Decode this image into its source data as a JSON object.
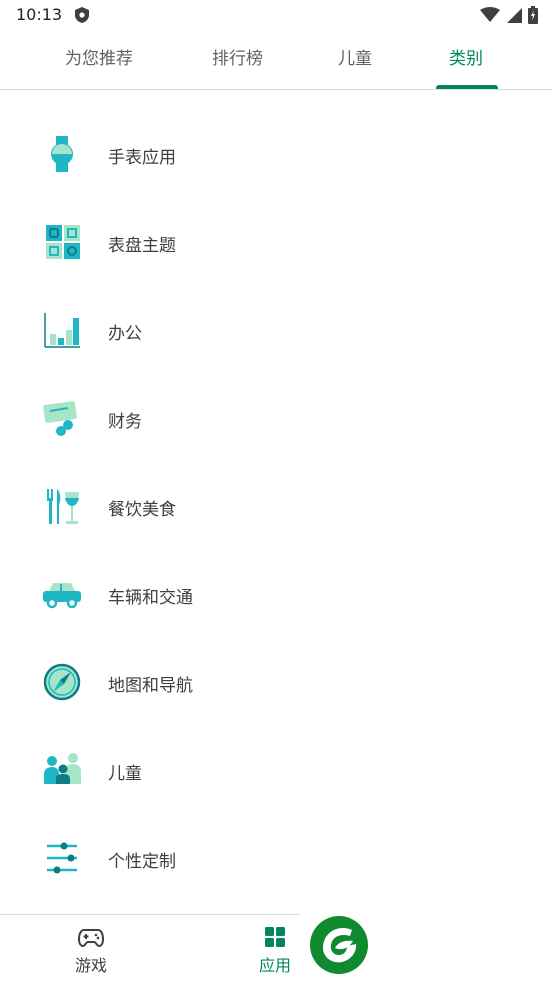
{
  "status": {
    "time": "10:13"
  },
  "tabs": [
    {
      "label": "为您推荐"
    },
    {
      "label": "排行榜"
    },
    {
      "label": "儿童"
    },
    {
      "label": "类别"
    }
  ],
  "categories": [
    {
      "label": "手表应用",
      "icon": "watch-icon"
    },
    {
      "label": "表盘主题",
      "icon": "watch-faces-icon"
    },
    {
      "label": "办公",
      "icon": "productivity-chart-icon"
    },
    {
      "label": "财务",
      "icon": "finance-card-icon"
    },
    {
      "label": "餐饮美食",
      "icon": "food-drink-icon"
    },
    {
      "label": "车辆和交通",
      "icon": "car-icon"
    },
    {
      "label": "地图和导航",
      "icon": "compass-icon"
    },
    {
      "label": "儿童",
      "icon": "family-icon"
    },
    {
      "label": "个性定制",
      "icon": "sliders-icon"
    }
  ],
  "bottom_nav": [
    {
      "label": "游戏",
      "icon": "gamepad-icon"
    },
    {
      "label": "应用",
      "icon": "apps-grid-icon"
    }
  ],
  "colors": {
    "accent": "#01875f",
    "teal": "#1fb7c6",
    "mint": "#a8e4c8"
  }
}
